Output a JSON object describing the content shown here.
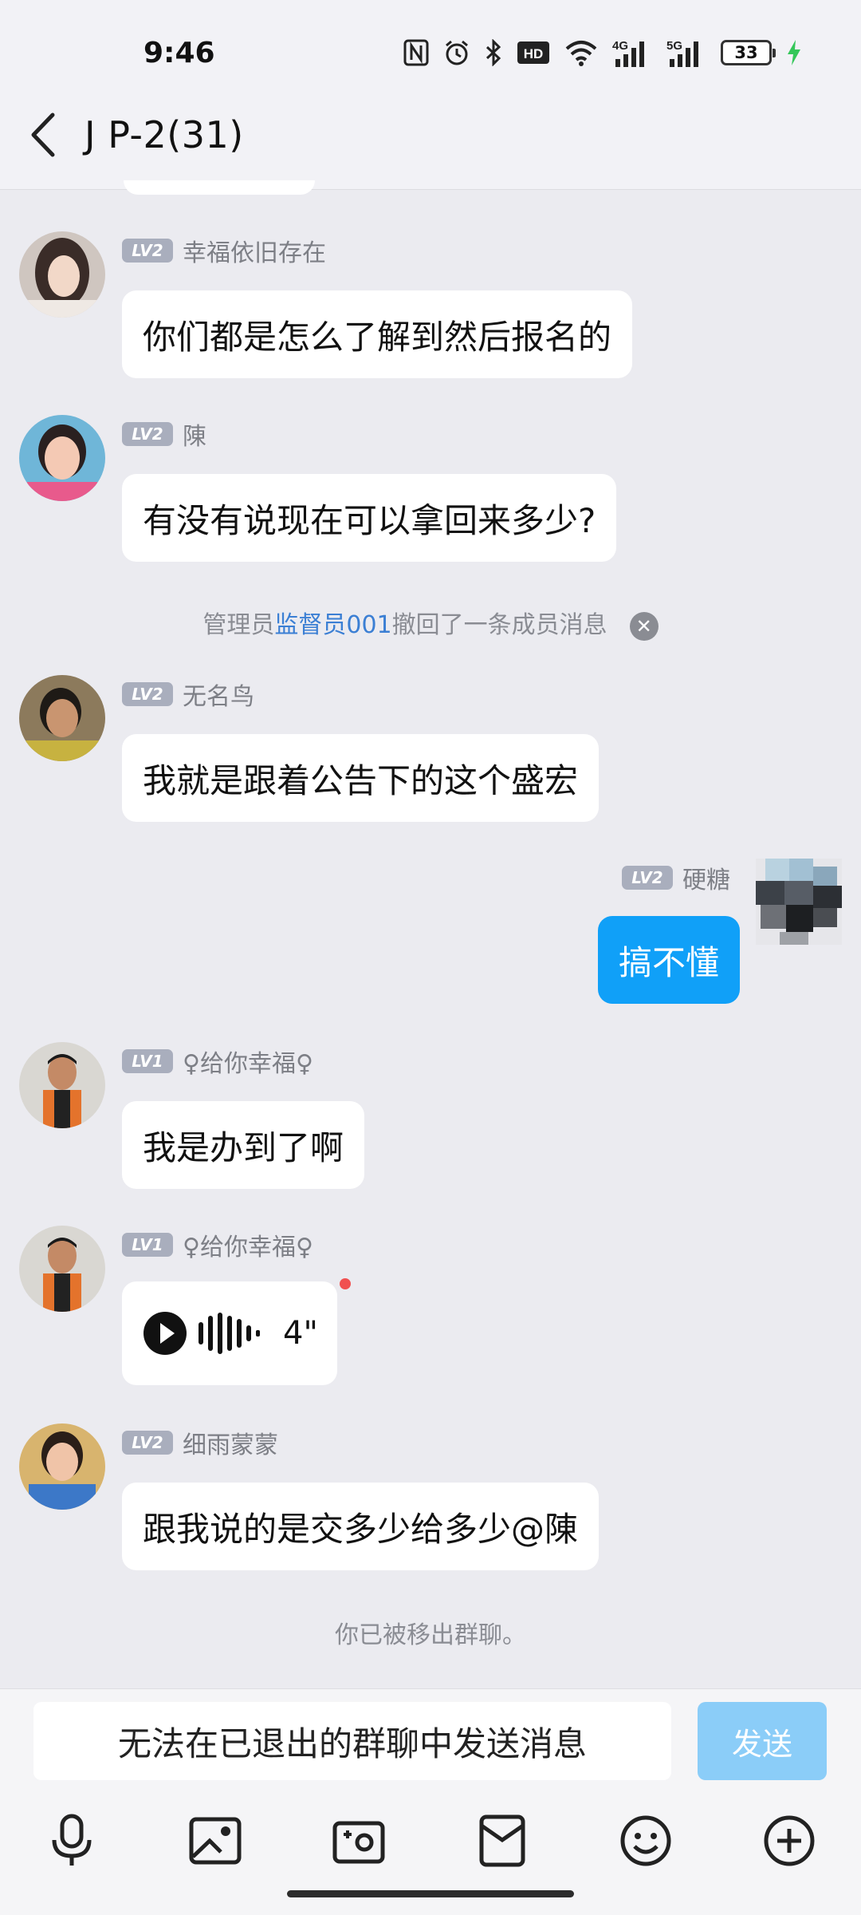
{
  "status_bar": {
    "time": "9:46",
    "battery": "33",
    "network_1": "4G",
    "network_2": "5G",
    "hd_label": "HD"
  },
  "header": {
    "title": "J P-2(31)"
  },
  "messages": [
    {
      "level": "LV2",
      "nickname": "幸福依旧存在",
      "text": "你们都是怎么了解到然后报名的"
    },
    {
      "level": "LV2",
      "nickname": "陳",
      "text": "有没有说现在可以拿回来多少?"
    },
    {
      "level": "LV2",
      "nickname": "无名鸟",
      "text": "我就是跟着公告下的这个盛宏"
    },
    {
      "level": "LV2",
      "nickname": "硬糖",
      "text": "搞不懂"
    },
    {
      "level": "LV1",
      "nickname": "♀给你幸福♀",
      "text": "我是办到了啊"
    },
    {
      "level": "LV1",
      "nickname": "♀给你幸福♀",
      "voice_duration": "4\""
    },
    {
      "level": "LV2",
      "nickname": "细雨蒙蒙",
      "text": "跟我说的是交多少给多少@陳"
    }
  ],
  "system": {
    "recall_prefix": "管理员",
    "recall_admin": "监督员001",
    "recall_suffix": "撤回了一条成员消息",
    "removed": "你已被移出群聊。"
  },
  "input": {
    "placeholder": "无法在已退出的群聊中发送消息",
    "send_label": "发送"
  },
  "toolbar": [
    "mic-icon",
    "image-icon",
    "camera-icon",
    "red-packet-icon",
    "emoji-icon",
    "plus-icon"
  ],
  "colors": {
    "background": "#ebebf0",
    "self_bubble": "#10a0f8",
    "send_disabled": "#8bcdf8",
    "link": "#3b7fd4",
    "level_badge": "#a9aebd"
  }
}
